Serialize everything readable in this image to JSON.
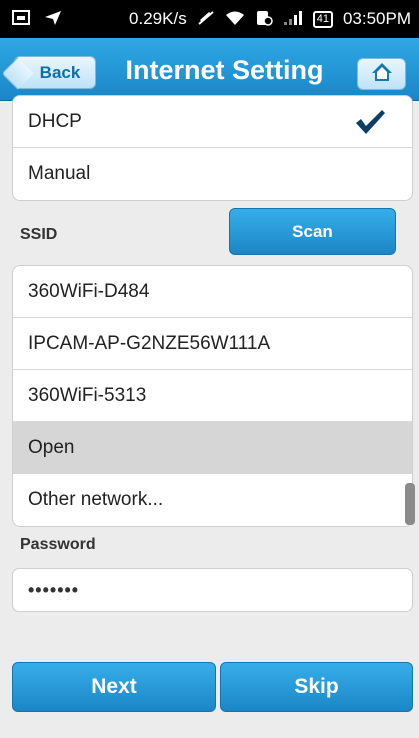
{
  "status_bar": {
    "speed": "0.29K/s",
    "battery": "41",
    "time": "03:50PM",
    "icons": [
      "screenshot-icon",
      "location-icon",
      "mute-icon",
      "wifi-icon",
      "sim-off-icon",
      "signal-icon",
      "battery-icon"
    ]
  },
  "header": {
    "back_label": "Back",
    "title": "Internet Setting",
    "home_icon": "home-icon",
    "color": "#1f95d6"
  },
  "mode_options": [
    {
      "label": "DHCP",
      "checked": true
    },
    {
      "label": "Manual",
      "checked": false
    }
  ],
  "ssid": {
    "label": "SSID",
    "scan_label": "Scan",
    "networks": [
      {
        "name": "360WiFi-D484"
      },
      {
        "name": "IPCAM-AP-G2NZE56W111A"
      },
      {
        "name": "360WiFi-5313"
      },
      {
        "name": "Open",
        "selected": true
      },
      {
        "name": "Other network..."
      }
    ]
  },
  "password": {
    "label": "Password",
    "value": "•••••••"
  },
  "buttons": {
    "next": "Next",
    "skip": "Skip"
  }
}
